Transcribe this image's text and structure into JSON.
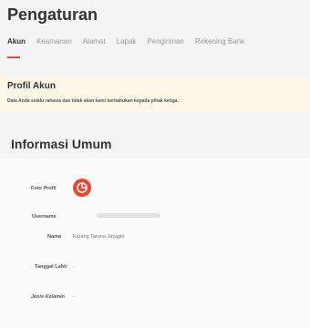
{
  "page_title": "Pengaturan",
  "tabs": [
    {
      "label": "Akun",
      "active": true
    },
    {
      "label": "Keamanan",
      "active": false,
      "dot": true
    },
    {
      "label": "Alamat",
      "active": false
    },
    {
      "label": "Lapak",
      "active": false
    },
    {
      "label": "Pengiriman",
      "active": false
    },
    {
      "label": "Rekening Bank",
      "active": false
    }
  ],
  "notice": {
    "title": "Profil Akun",
    "text": "Data Anda selalu rahasia dan tidak akan kami beritahukan kepada pihak ketiga."
  },
  "section_title": "Informasi Umum",
  "fields": {
    "photo_label": "Foto Profil",
    "username_label": "Username",
    "name_label": "Nama",
    "name_value": "Karang Taruna Jayagiri",
    "birthdate_label": "Tanggal Lahir",
    "birthdate_value": "-",
    "gender_label": "Jenis Kelamin",
    "gender_value": "-"
  },
  "colors": {
    "accent": "#e8472e",
    "notice_bg": "#fdf6e6"
  }
}
